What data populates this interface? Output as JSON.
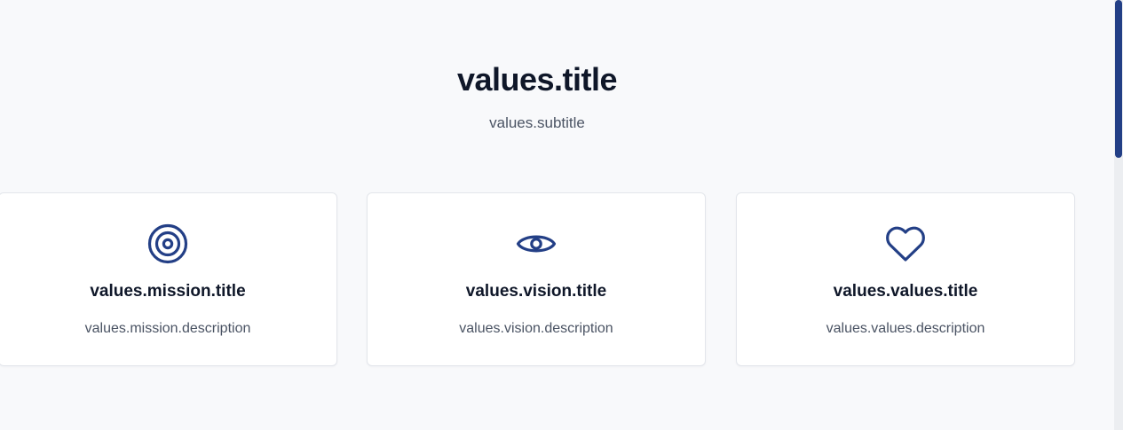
{
  "section": {
    "title": "values.title",
    "subtitle": "values.subtitle"
  },
  "cards": [
    {
      "icon": "target-icon",
      "title": "values.mission.title",
      "description": "values.mission.description"
    },
    {
      "icon": "eye-icon",
      "title": "values.vision.title",
      "description": "values.vision.description"
    },
    {
      "icon": "heart-icon",
      "title": "values.values.title",
      "description": "values.values.description"
    }
  ],
  "colors": {
    "accent": "#233f86",
    "heading": "#0f1729",
    "muted": "#4a5363",
    "background": "#f8f9fb",
    "card": "#ffffff"
  }
}
